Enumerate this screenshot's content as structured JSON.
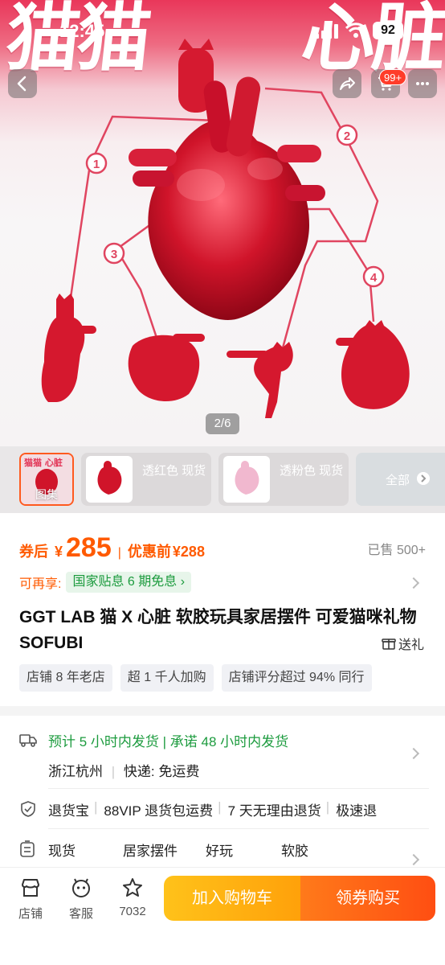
{
  "status": {
    "time": "12:45",
    "battery": "92"
  },
  "hero": {
    "title_left": "猫猫",
    "title_right": "心脏",
    "page_indicator": "2/6",
    "callouts": [
      "1",
      "2",
      "3",
      "4"
    ],
    "cart_badge": "99+"
  },
  "thumbs": {
    "gallery_label": "图集",
    "variants": [
      {
        "label": "透红色 现货"
      },
      {
        "label": "透粉色 现货"
      }
    ],
    "all_label": "全部"
  },
  "price": {
    "coupon_label": "券后",
    "currency": "¥",
    "after_coupon": "285",
    "separator": "|",
    "before_label": "优惠前",
    "before_price": "¥288",
    "sold": "已售 500+"
  },
  "enjoy": {
    "label": "可再享:",
    "subsidy": "国家贴息 6 期免息"
  },
  "product": {
    "title": "GGT LAB 猫 X 心脏 软胶玩具家居摆件 可爱猫咪礼物 SOFUBI",
    "gift": "送礼"
  },
  "tags": [
    "店铺 8 年老店",
    "超 1 千人加购",
    "店铺评分超过 94% 同行"
  ],
  "shipping": {
    "estimate": "预计 5 小时内发货 | 承诺 48 小时内发货",
    "location": "浙江杭州",
    "delivery_label": "快递:",
    "delivery_value": "免运费"
  },
  "services": [
    "退货宝",
    "88VIP 退货包运费",
    "7 天无理由退货",
    "极速退"
  ],
  "attributes": [
    "现货",
    "居家摆件",
    "好玩",
    "软胶"
  ],
  "bottom": {
    "shop": "店铺",
    "service": "客服",
    "favorites": "7032",
    "add_cart": "加入购物车",
    "buy": "领券购买"
  },
  "colors": {
    "accent": "#ff5a00",
    "green": "#1c9b3e",
    "hero_red": "#e9375a",
    "figure_red": "#d0142a"
  },
  "icons": [
    "back-icon",
    "share-icon",
    "cart-icon",
    "more-icon",
    "truck-icon",
    "shield-check-icon",
    "list-icon",
    "shop-icon",
    "service-icon",
    "star-icon",
    "gift-icon"
  ]
}
